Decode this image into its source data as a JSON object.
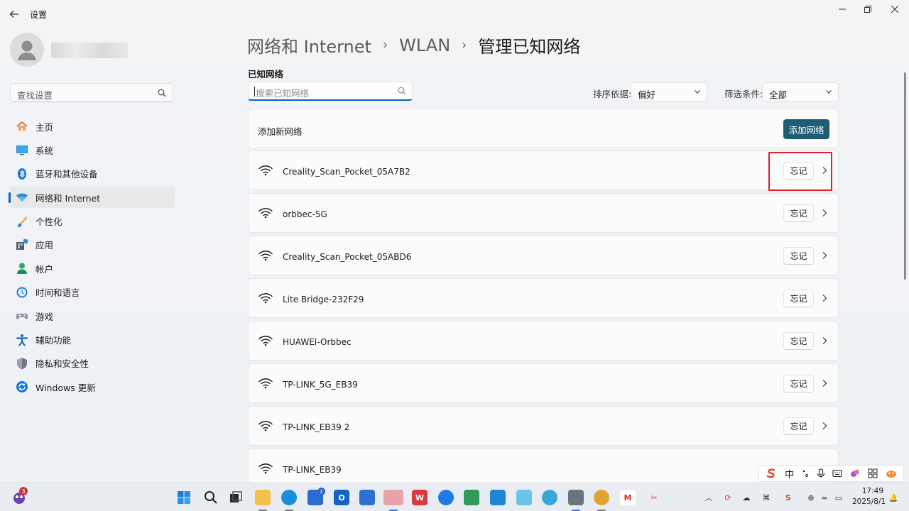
{
  "window": {
    "title": "设置"
  },
  "sidebar": {
    "search_placeholder": "查找设置",
    "items": [
      {
        "label": "主页",
        "icon": "home-icon",
        "active": false
      },
      {
        "label": "系统",
        "icon": "system-icon",
        "active": false
      },
      {
        "label": "蓝牙和其他设备",
        "icon": "bluetooth-icon",
        "active": false
      },
      {
        "label": "网络和 Internet",
        "icon": "network-icon",
        "active": true
      },
      {
        "label": "个性化",
        "icon": "brush-icon",
        "active": false
      },
      {
        "label": "应用",
        "icon": "apps-icon",
        "active": false
      },
      {
        "label": "帐户",
        "icon": "account-icon",
        "active": false
      },
      {
        "label": "时间和语言",
        "icon": "time-language-icon",
        "active": false
      },
      {
        "label": "游戏",
        "icon": "gamepad-icon",
        "active": false
      },
      {
        "label": "辅助功能",
        "icon": "accessibility-icon",
        "active": false
      },
      {
        "label": "隐私和安全性",
        "icon": "shield-icon",
        "active": false
      },
      {
        "label": "Windows 更新",
        "icon": "update-icon",
        "active": false
      }
    ]
  },
  "main": {
    "breadcrumb": [
      "网络和 Internet",
      "WLAN",
      "管理已知网络"
    ],
    "section_title": "已知网络",
    "network_search_placeholder": "搜索已知网络",
    "sort_label": "排序依据:",
    "sort_value": "偏好",
    "filter_label": "筛选条件:",
    "filter_value": "全部",
    "add_network": {
      "label": "添加新网络",
      "button": "添加网络"
    },
    "forget_label": "忘记",
    "networks": [
      "Creality_Scan_Pocket_05A7B2",
      "orbbec-5G",
      "Creality_Scan_Pocket_05ABD6",
      "Lite Bridge-232F29",
      "HUAWEI-Orbbec",
      "TP-LINK_5G_EB39",
      "TP-LINK_EB39 2",
      "TP-LINK_EB39"
    ]
  },
  "ime": {
    "mode": "中"
  },
  "taskbar": {
    "notification_count": "3",
    "outlook_badge": "1",
    "time": "17:49",
    "date": "2025/8/1"
  },
  "colors": {
    "accent": "#0067c0",
    "add_button": "#1e5d74",
    "highlight": "#e0202a"
  }
}
